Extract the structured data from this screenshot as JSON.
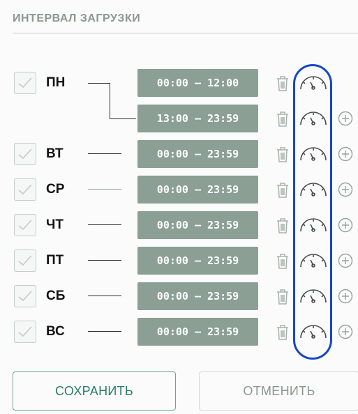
{
  "section": {
    "title": "ИНТЕРВАЛ ЗАГРУЗКИ"
  },
  "days": [
    {
      "label": "ПН",
      "checked": true,
      "intervals": [
        "00:00 – 12:00",
        "13:00 – 23:59"
      ]
    },
    {
      "label": "ВТ",
      "checked": true,
      "intervals": [
        "00:00 – 23:59"
      ]
    },
    {
      "label": "СР",
      "checked": true,
      "intervals": [
        "00:00 – 23:59"
      ]
    },
    {
      "label": "ЧТ",
      "checked": true,
      "intervals": [
        "00:00 – 23:59"
      ]
    },
    {
      "label": "ПТ",
      "checked": true,
      "intervals": [
        "00:00 – 23:59"
      ]
    },
    {
      "label": "СБ",
      "checked": true,
      "intervals": [
        "00:00 – 23:59"
      ]
    },
    {
      "label": "ВС",
      "checked": true,
      "intervals": [
        "00:00 – 23:59"
      ]
    }
  ],
  "icons": {
    "delete": "trash-icon",
    "limit": "gauge-icon",
    "add": "plus-circle-icon"
  },
  "buttons": {
    "save_label": "СОХРАНИТЬ",
    "cancel_label": "ОТМЕНИТЬ"
  },
  "colors": {
    "interval_bg": "#8b9f95",
    "accent": "#2b7e66",
    "highlight": "#1747c9"
  }
}
